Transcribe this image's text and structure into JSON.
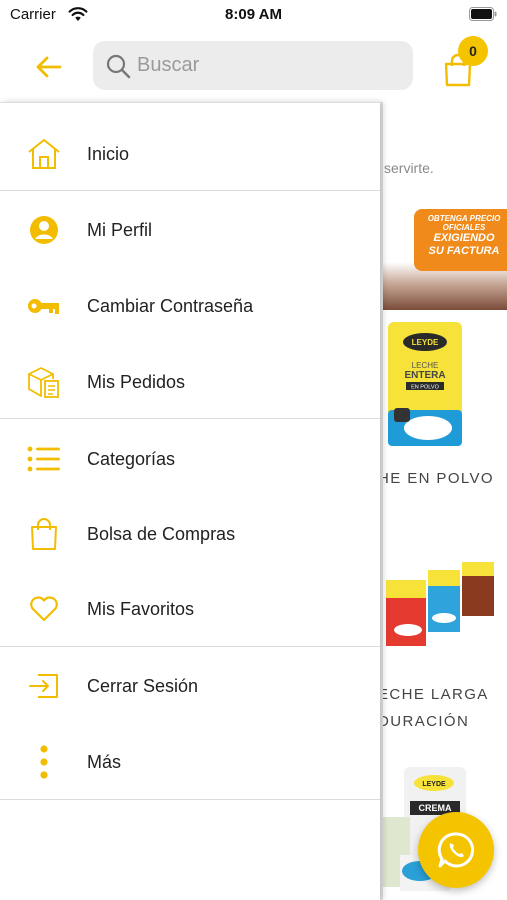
{
  "status_bar": {
    "carrier": "Carrier",
    "time": "8:09 AM"
  },
  "header": {
    "search_placeholder": "Buscar",
    "cart_count": "0"
  },
  "colors": {
    "accent": "#f5c400",
    "icon": "#f2bd00",
    "text": "#222222",
    "divider": "#dcdcdc"
  },
  "drawer": {
    "items": [
      {
        "label": "Inicio",
        "icon": "home-icon"
      },
      {
        "label": "Mi Perfil",
        "icon": "profile-icon"
      },
      {
        "label": "Cambiar Contraseña",
        "icon": "key-icon"
      },
      {
        "label": "Mis Pedidos",
        "icon": "orders-icon"
      },
      {
        "label": "Categorías",
        "icon": "list-icon"
      },
      {
        "label": "Bolsa de Compras",
        "icon": "shopping-bag-icon"
      },
      {
        "label": "Mis Favoritos",
        "icon": "heart-icon"
      },
      {
        "label": "Cerrar Sesión",
        "icon": "logout-icon"
      },
      {
        "label": "Más",
        "icon": "more-vertical-icon"
      }
    ]
  },
  "background": {
    "intro_text": "servirte.",
    "banner": {
      "line1": "OBTENGA PRECIO",
      "line2": "OFICIALES",
      "line3": "EXIGIENDO",
      "line4": "SU FACTURA"
    },
    "products": [
      {
        "title_line1": "HE EN POLVO",
        "title_line2": ""
      },
      {
        "title_line1": "ECHE LARGA",
        "title_line2": "DURACIÓN"
      }
    ],
    "pack_labels": {
      "brand": "LEYDE",
      "milk_line1": "LECHE",
      "milk_line2": "ENTERA",
      "milk_line3": "EN POLVO",
      "cream_line1": "CREMA"
    }
  },
  "fab": {
    "icon": "whatsapp-icon"
  }
}
